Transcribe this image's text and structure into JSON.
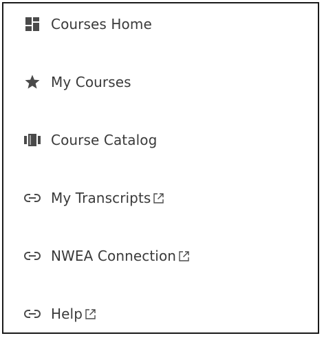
{
  "nav": {
    "items": [
      {
        "label": "Courses Home",
        "icon": "dashboard-icon",
        "external": false
      },
      {
        "label": "My Courses",
        "icon": "star-icon",
        "external": false
      },
      {
        "label": "Course Catalog",
        "icon": "catalog-icon",
        "external": false
      },
      {
        "label": "My Transcripts",
        "icon": "link-icon",
        "external": true
      },
      {
        "label": "NWEA Connection",
        "icon": "link-icon",
        "external": true
      },
      {
        "label": "Help",
        "icon": "link-icon",
        "external": true
      }
    ]
  },
  "colors": {
    "text": "#3a3a3a",
    "icon": "#4a4a4a",
    "border": "#1a1a1a"
  }
}
